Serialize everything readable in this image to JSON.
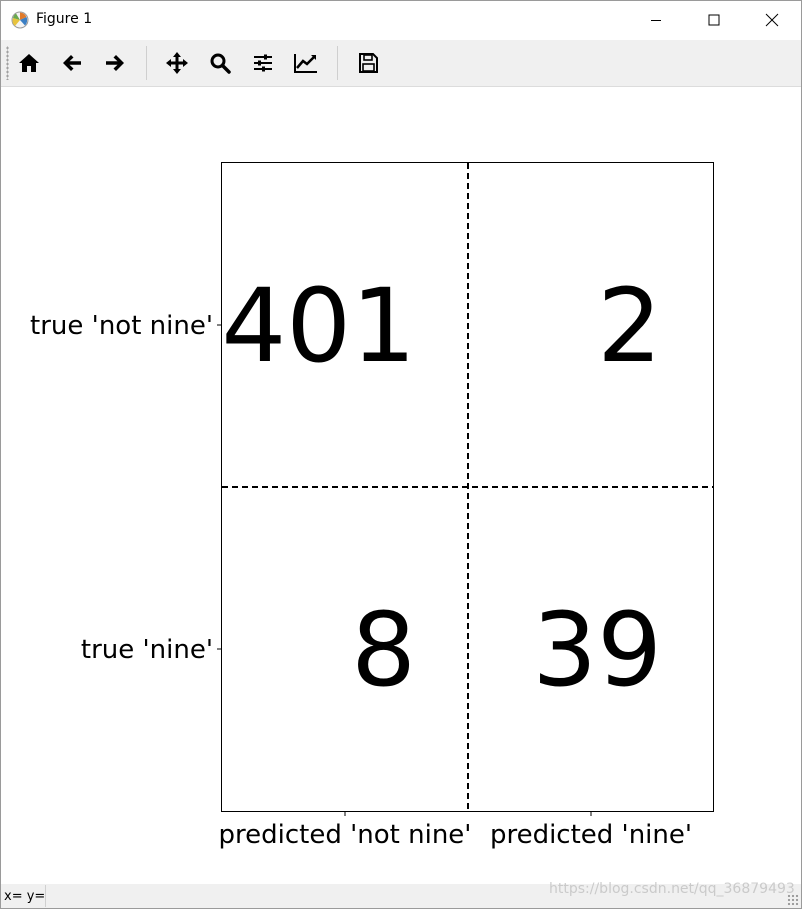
{
  "window": {
    "title": "Figure 1",
    "icons": [
      "matplotlib-logo-icon",
      "minimize-icon",
      "maximize-icon",
      "close-icon"
    ]
  },
  "toolbar": {
    "items": [
      "home-icon",
      "back-arrow-icon",
      "forward-arrow-icon",
      "pan-icon",
      "zoom-icon",
      "configure-subplots-icon",
      "edit-axis-icon",
      "save-icon"
    ]
  },
  "status": {
    "coords": "x= y="
  },
  "watermark": "https://blog.csdn.net/qq_36879493",
  "chart_data": {
    "type": "table",
    "title": "",
    "xlabel": "",
    "ylabel": "",
    "x_tick_labels": [
      "predicted 'not nine'",
      "predicted 'nine'"
    ],
    "y_tick_labels": [
      "true 'not nine'",
      "true 'nine'"
    ],
    "cells": [
      [
        401,
        2
      ],
      [
        8,
        39
      ]
    ],
    "cell_labels": [
      [
        "401",
        "2"
      ],
      [
        "8",
        "39"
      ]
    ],
    "grid_style": "dashed",
    "text_color": "#000000"
  }
}
